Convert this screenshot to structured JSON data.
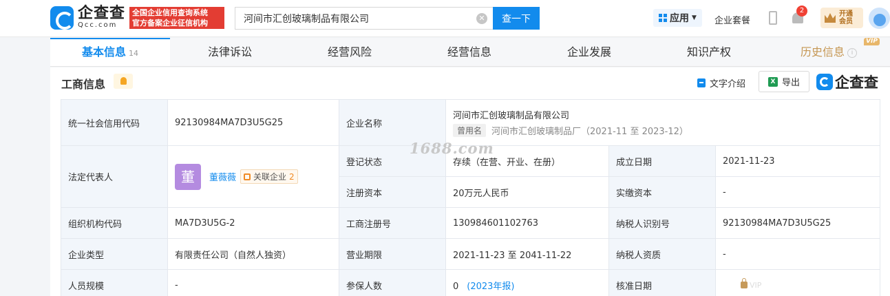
{
  "header": {
    "logo_cn": "企查查",
    "logo_en": "Qcc.com",
    "slogan_line1": "全国企业信用查询系统",
    "slogan_line2": "官方备案企业征信机构",
    "search_value": "河间市汇创玻璃制品有限公司",
    "search_button": "查一下",
    "apps_label": "应用",
    "package_label": "企业套餐",
    "notification_count": "2",
    "vip_line1": "开通",
    "vip_line2": "会员"
  },
  "tabs": [
    {
      "label": "基本信息",
      "count": "14"
    },
    {
      "label": "法律诉讼"
    },
    {
      "label": "经营风险"
    },
    {
      "label": "经营信息"
    },
    {
      "label": "企业发展"
    },
    {
      "label": "知识产权"
    },
    {
      "label": "历史信息",
      "badge": "VIP"
    }
  ],
  "section": {
    "title": "工商信息",
    "text_intro": "文字介绍",
    "export": "导出",
    "brand": "企查查"
  },
  "watermark": "1688.com",
  "info": {
    "credit_code_label": "统一社会信用代码",
    "credit_code": "92130984MA7D3U5G25",
    "company_name_label": "企业名称",
    "company_name": "河间市汇创玻璃制品有限公司",
    "former_tag": "曾用名",
    "former_name": "河间市汇创玻璃制品厂（2021-11 至 2023-12）",
    "legal_rep_label": "法定代表人",
    "legal_rep_avatar": "董",
    "legal_rep_name": "董薇薇",
    "related_label": "关联企业",
    "related_count": "2",
    "reg_status_label": "登记状态",
    "reg_status": "存续（在营、开业、在册）",
    "found_date_label": "成立日期",
    "found_date": "2021-11-23",
    "reg_capital_label": "注册资本",
    "reg_capital": "20万元人民币",
    "paid_capital_label": "实缴资本",
    "paid_capital": "-",
    "org_code_label": "组织机构代码",
    "org_code": "MA7D3U5G-2",
    "business_reg_label": "工商注册号",
    "business_reg": "130984601102763",
    "taxpayer_id_label": "纳税人识别号",
    "taxpayer_id": "92130984MA7D3U5G25",
    "company_type_label": "企业类型",
    "company_type": "有限责任公司（自然人独资）",
    "business_term_label": "营业期限",
    "business_term": "2021-11-23 至 2041-11-22",
    "taxpayer_qual_label": "纳税人资质",
    "taxpayer_qual": "-",
    "staff_size_label": "人员规模",
    "staff_size": "-",
    "insured_label": "参保人数",
    "insured_count": "0",
    "insured_year": "(2023年报)",
    "approval_date_label": "核准日期",
    "approval_locked": "VIP"
  }
}
